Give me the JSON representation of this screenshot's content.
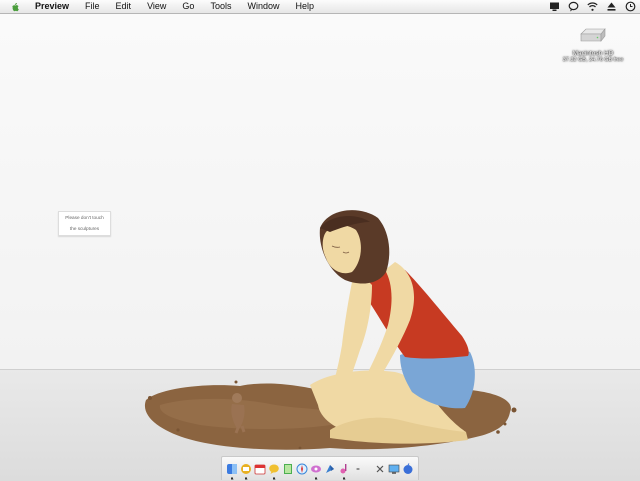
{
  "menubar": {
    "app_name": "Preview",
    "items": [
      "File",
      "Edit",
      "View",
      "Go",
      "Tools",
      "Window",
      "Help"
    ],
    "status_icons": [
      "display-icon",
      "speech-bubble-icon",
      "wifi-icon",
      "eject-icon",
      "clock-icon"
    ]
  },
  "desktop": {
    "drive": {
      "name": "Macintosh HD",
      "info": "37.32 GB, 24.76 GB free"
    },
    "sign": {
      "line1": "Please don't touch",
      "line2": "the sculptures"
    }
  },
  "dock": {
    "items": [
      "finder-icon",
      "mail-icon",
      "ical-icon",
      "ichat-icon",
      "notes-icon",
      "safari-icon",
      "photo-icon",
      "preview-icon",
      "itunes-icon",
      "more-icon",
      "trash-icon",
      "screen-icon",
      "apps-icon"
    ]
  },
  "colors": {
    "wall": "#f5f5f5",
    "floor": "#e0e0e0",
    "mud": "#8b6440",
    "top": "#c73a22",
    "shorts": "#7aa6d6",
    "hair": "#5a3a28",
    "skin": "#f0d9a4"
  }
}
